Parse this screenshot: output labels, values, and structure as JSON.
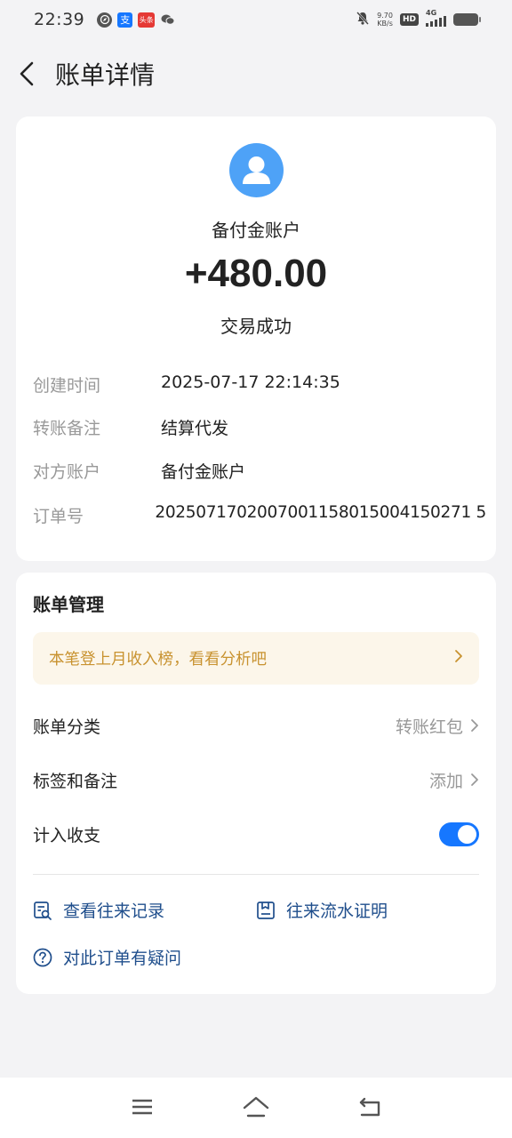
{
  "status_bar": {
    "time": "22:39",
    "net_speed_value": "9.70",
    "net_speed_unit": "KB/s",
    "hd_badge": "HD",
    "network": "4G",
    "left_icons": [
      "compass-icon",
      "alipay-icon",
      "news-icon",
      "wechat-icon"
    ],
    "right_icons": [
      "mute-icon",
      "hd-icon",
      "signal-icon",
      "battery-icon"
    ]
  },
  "header": {
    "title": "账单详情",
    "back_icon": "chevron-left-icon"
  },
  "summary": {
    "account_name": "备付金账户",
    "amount": "+480.00",
    "status": "交易成功",
    "avatar_icon": "user-icon"
  },
  "details": [
    {
      "label": "创建时间",
      "value": "2025-07-17 22:14:35"
    },
    {
      "label": "转账备注",
      "value": "结算代发"
    },
    {
      "label": "对方账户",
      "value": "备付金账户"
    },
    {
      "label": "订单号",
      "value": "2025071702007001158015004150271 5"
    }
  ],
  "management": {
    "title": "账单管理",
    "promo_text": "本笔登上月收入榜，看看分析吧",
    "category_label": "账单分类",
    "category_value": "转账红包",
    "tags_label": "标签和备注",
    "tags_value": "添加",
    "include_label": "计入收支",
    "include_enabled": true,
    "link_records": "查看往来记录",
    "link_statement": "往来流水证明",
    "link_question": "对此订单有疑问"
  },
  "colors": {
    "accent": "#1677ff",
    "link": "#1f4e8c",
    "promo_text": "#c8922f",
    "promo_bg": "#fcf6ea",
    "avatar": "#4ea2f7"
  },
  "system_nav": [
    "menu-icon",
    "home-icon",
    "back-icon"
  ]
}
